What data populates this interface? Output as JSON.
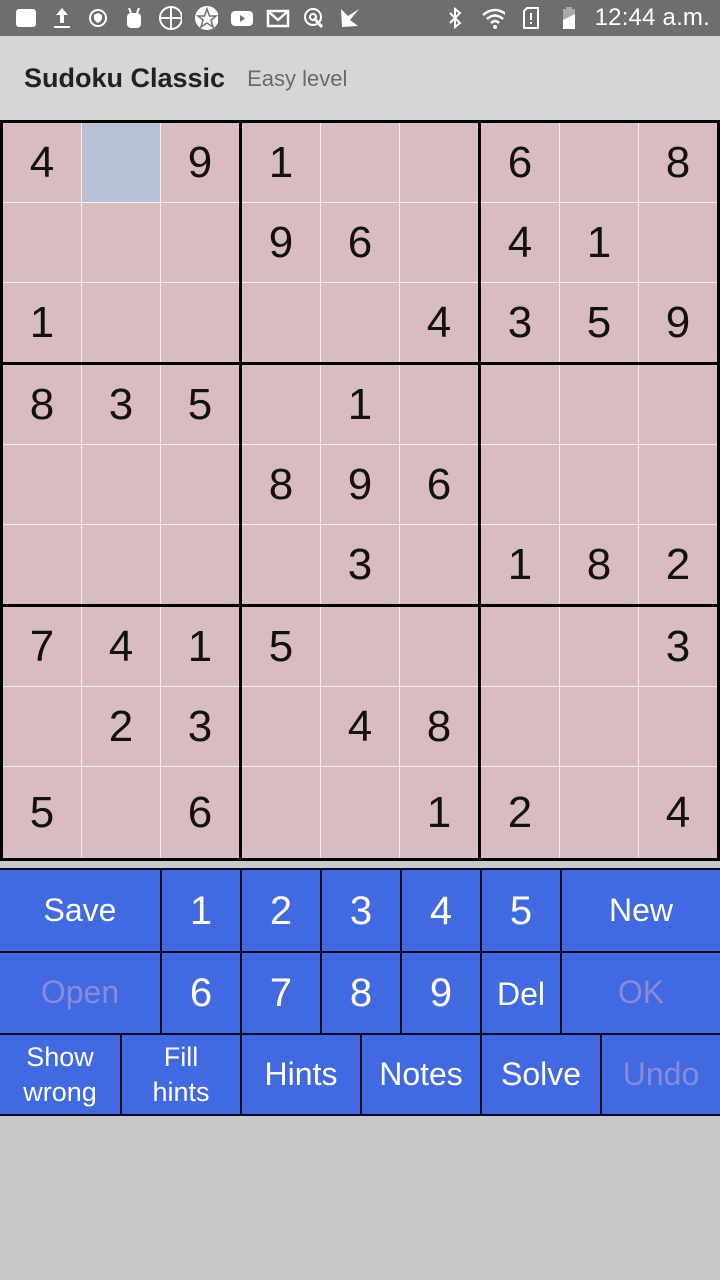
{
  "status_bar": {
    "time": "12:44 a.m.",
    "left_icons": [
      "app-square-icon",
      "upload-icon",
      "vpn-shield-icon",
      "android-robot-icon",
      "crosshair-icon",
      "star-badge-icon",
      "youtube-icon",
      "gmail-icon",
      "touch-icon",
      "checkmark-app-icon"
    ],
    "right_icons": [
      "bluetooth-icon",
      "wifi-icon",
      "sim-alert-icon",
      "battery-charging-icon"
    ]
  },
  "app_bar": {
    "title": "Sudoku Classic",
    "subtitle": "Easy level"
  },
  "board": {
    "selected": [
      0,
      1
    ],
    "rows": [
      [
        "4",
        "",
        "9",
        "1",
        "",
        "",
        "6",
        "",
        "8"
      ],
      [
        "",
        "",
        "",
        "9",
        "6",
        "",
        "4",
        "1",
        ""
      ],
      [
        "1",
        "",
        "",
        "",
        "",
        "4",
        "3",
        "5",
        "9"
      ],
      [
        "8",
        "3",
        "5",
        "",
        "1",
        "",
        "",
        "",
        ""
      ],
      [
        "",
        "",
        "",
        "8",
        "9",
        "6",
        "",
        "",
        ""
      ],
      [
        "",
        "",
        "",
        "",
        "3",
        "",
        "1",
        "8",
        "2"
      ],
      [
        "7",
        "4",
        "1",
        "5",
        "",
        "",
        "",
        "",
        "3"
      ],
      [
        "",
        "2",
        "3",
        "",
        "4",
        "8",
        "",
        "",
        ""
      ],
      [
        "5",
        "",
        "6",
        "",
        "",
        "1",
        "2",
        "",
        "4"
      ]
    ]
  },
  "keypad": {
    "save": "Save",
    "open": "Open",
    "new": "New",
    "ok": "OK",
    "digits": [
      "1",
      "2",
      "3",
      "4",
      "5",
      "6",
      "7",
      "8",
      "9"
    ],
    "del": "Del",
    "show_wrong_line1": "Show",
    "show_wrong_line2": "wrong",
    "fill_hints_line1": "Fill",
    "fill_hints_line2": "hints",
    "hints": "Hints",
    "notes": "Notes",
    "solve": "Solve",
    "undo": "Undo"
  },
  "colors": {
    "cell_bg": "#d8bcc0",
    "selected_cell_bg": "#b6c2d4",
    "key_bg": "#4169e1",
    "disabled_text": "#8a8ad8"
  }
}
